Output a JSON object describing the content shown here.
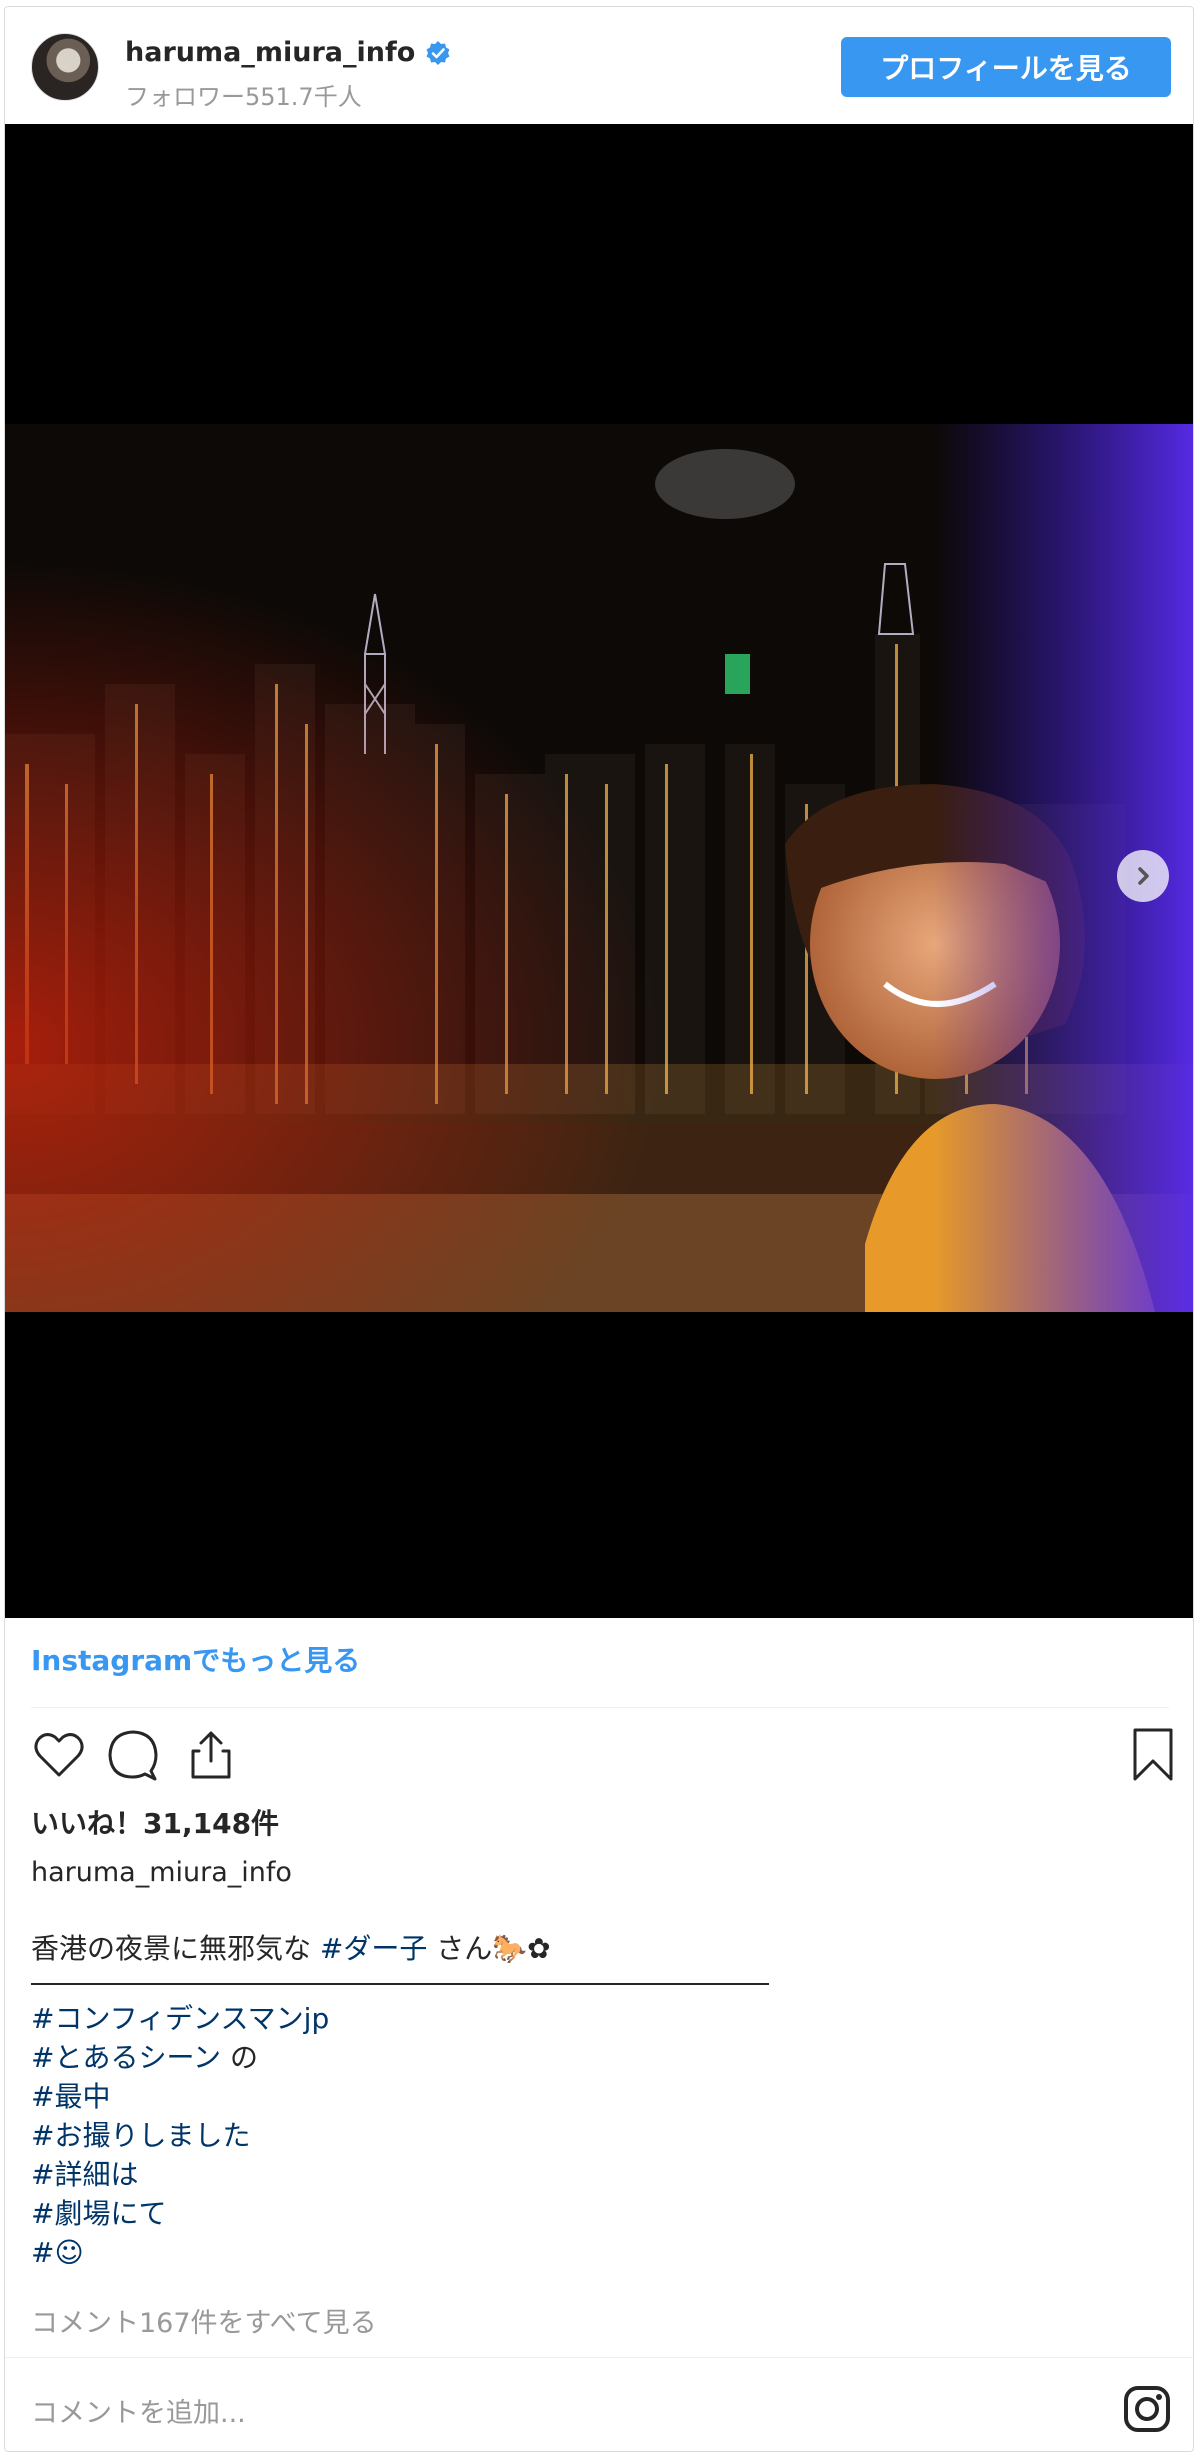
{
  "header": {
    "username": "haruma_miura_info",
    "followers": "フォロワー551.7千人",
    "profile_button": "プロフィールを見る"
  },
  "media": {
    "next_icon": "chevron-right-icon"
  },
  "footer": {
    "more_link": "Instagramでもっと見る",
    "likes": "いいね！31,148件",
    "caption_user": "haruma_miura_info",
    "caption_line1_text": "香港の夜景に無邪気な ",
    "caption_line1_tag": "#ダー子",
    "caption_line1_after": " さん🐎✿",
    "tags": [
      {
        "tag": "#コンフィデンスマンjp",
        "after": ""
      },
      {
        "tag": "#とあるシーン",
        "after": " の"
      },
      {
        "tag": "#最中",
        "after": ""
      },
      {
        "tag": "#お撮りしました",
        "after": ""
      },
      {
        "tag": "#詳細は",
        "after": ""
      },
      {
        "tag": "#劇場にて",
        "after": ""
      },
      {
        "tag": "#☺",
        "after": ""
      }
    ],
    "view_comments": "コメント167件をすべて見る",
    "add_comment": "コメントを追加...",
    "icons": [
      "heart-icon",
      "comment-icon",
      "share-icon",
      "bookmark-icon",
      "instagram-icon"
    ],
    "link_color": "#3897f0",
    "tag_color": "#003569"
  }
}
